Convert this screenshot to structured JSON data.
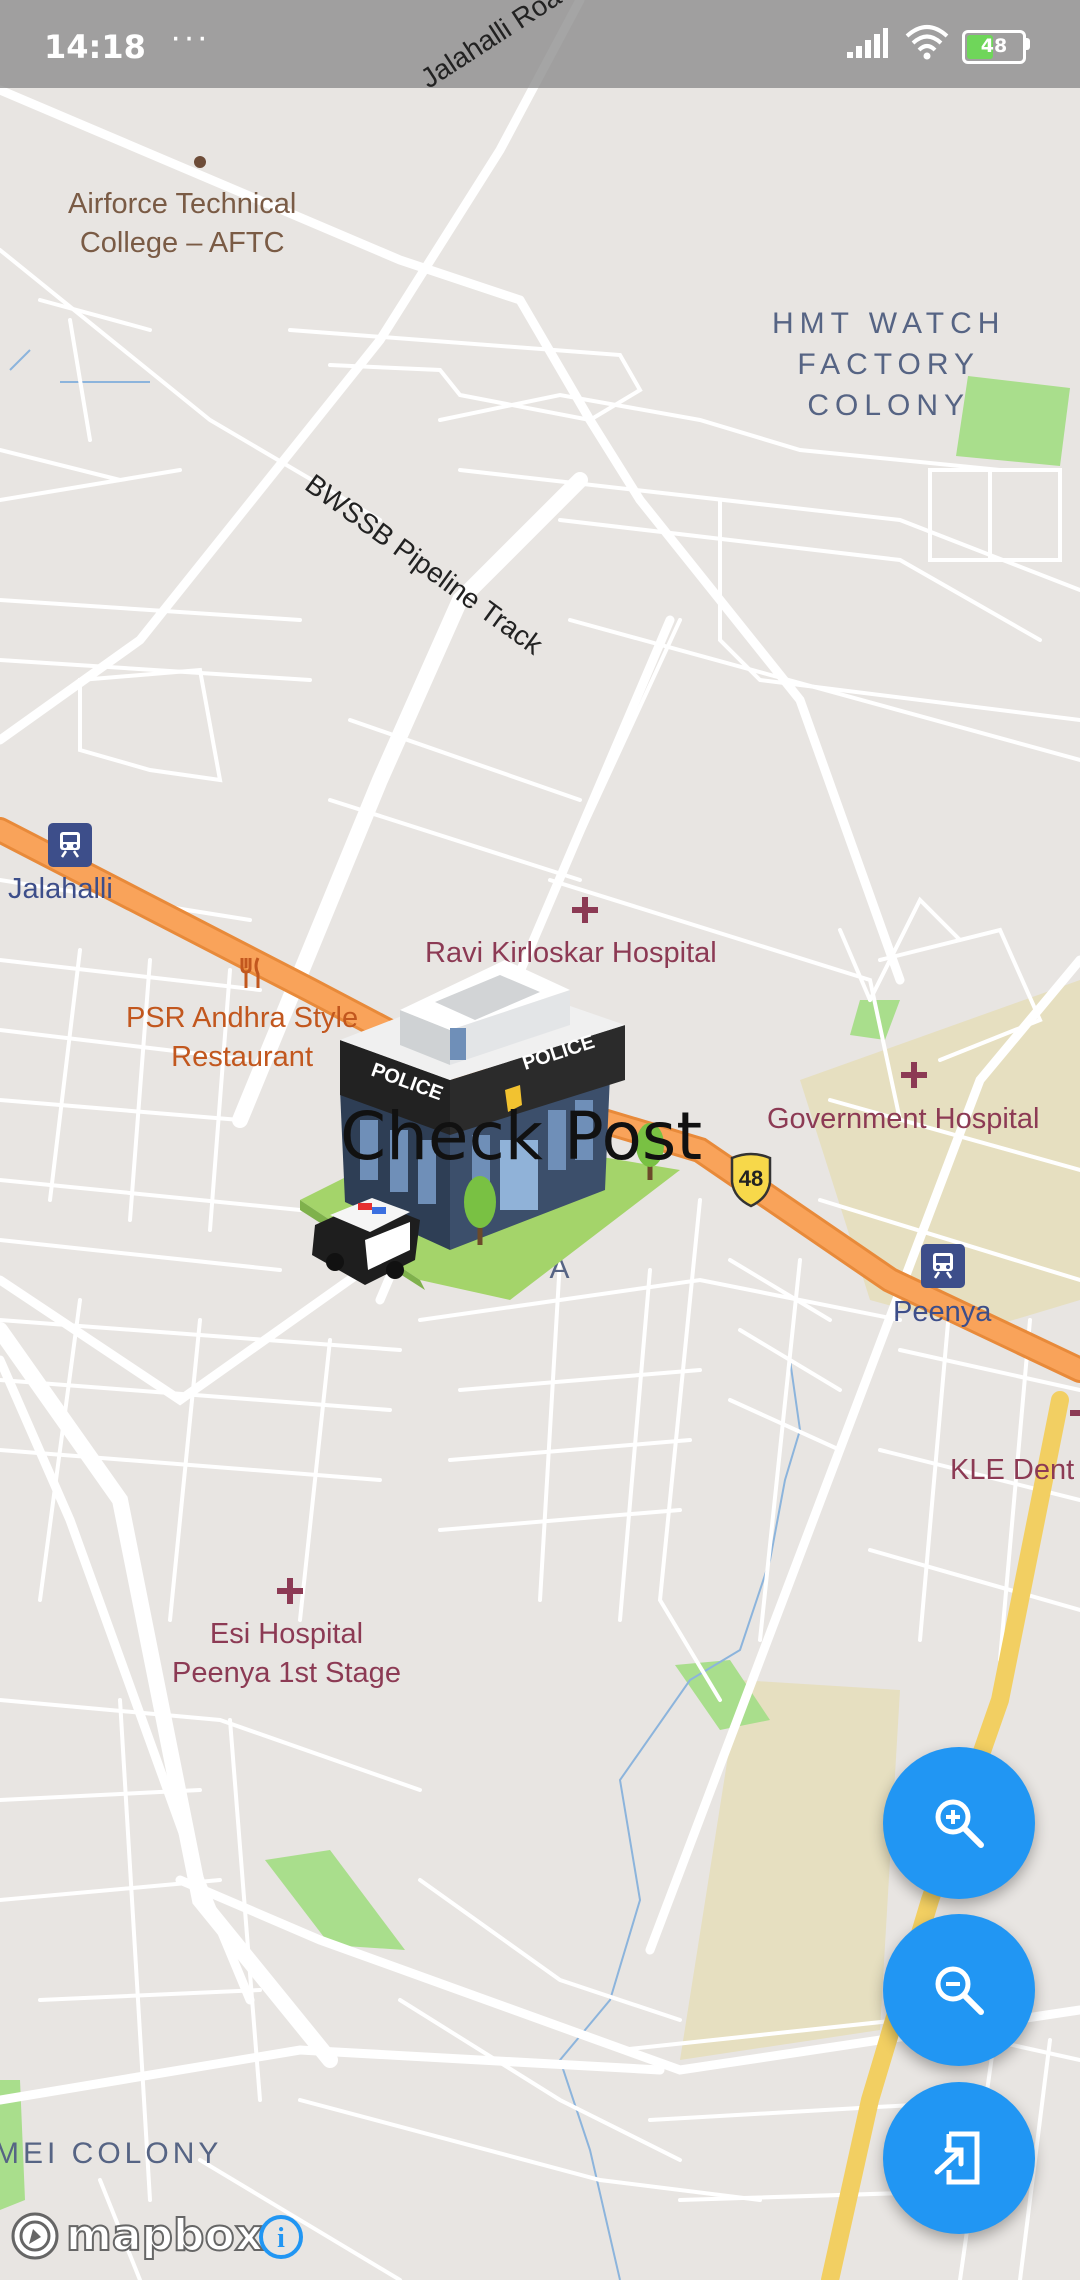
{
  "status_bar": {
    "time": "14:18",
    "overflow": "···",
    "battery_level": "48",
    "icons": [
      "signal-icon",
      "wifi-icon",
      "battery-icon"
    ]
  },
  "map": {
    "road_labels": {
      "jalahalli_road": "Jalahalli Road",
      "bwssb": "BWSSB Pipeline Track"
    },
    "places": {
      "aftc_line1": "Airforce Technical",
      "aftc_line2": "College – AFTC",
      "hmt_line1": "HMT WATCH",
      "hmt_line2": "FACTORY",
      "hmt_line3": "COLONY",
      "jalahalli_station": "Jalahalli",
      "ravi_hospital": "Ravi Kirloskar Hospital",
      "psr_line1": "PSR Andhra Style",
      "psr_line2": "Restaurant",
      "govt_hospital": "Government Hospital",
      "peenya_area": "PEENYA",
      "peenya_station": "Peenya",
      "kle": "KLE Dent",
      "esi_line1": "Esi Hospital",
      "esi_line2": "Peenya 1st Stage",
      "mei_colony": "MEI COLONY",
      "highway_shield": "48"
    },
    "marker": {
      "label": "Check Post",
      "building_sign": "POLICE"
    },
    "colors": {
      "land": "#e8e5e2",
      "road": "#ffffff",
      "highway": "#f9a35a",
      "park": "#a9de8c",
      "industrial": "#e6dfc0",
      "water": "#8cb4dc"
    }
  },
  "controls": {
    "zoom_in": "zoom-in-icon",
    "zoom_out": "zoom-out-icon",
    "recenter": "open-in-new-icon",
    "accent": "#2196f3"
  },
  "attribution": {
    "logo_text": "mapbox",
    "info": "i"
  }
}
